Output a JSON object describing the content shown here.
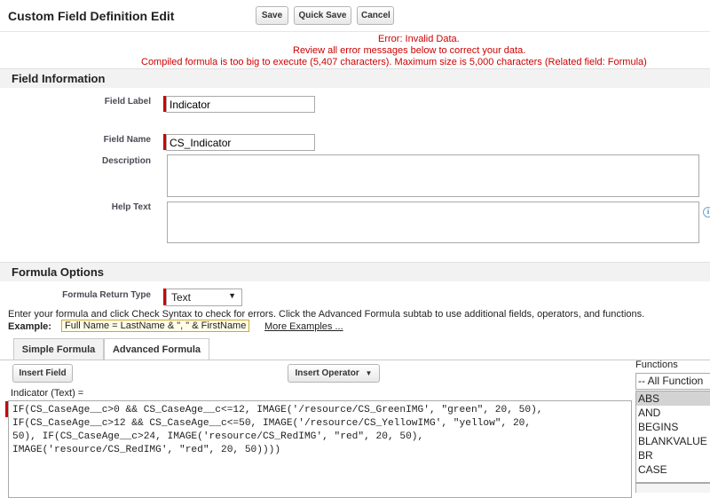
{
  "header": {
    "title": "Custom Field Definition Edit",
    "save_label": "Save",
    "quick_save_label": "Quick Save",
    "cancel_label": "Cancel"
  },
  "errors": {
    "line1": "Error: Invalid Data.",
    "line2": "Review all error messages below to correct your data.",
    "line3": "Compiled formula is too big to execute (5,407 characters). Maximum size is 5,000 characters (Related field: Formula)"
  },
  "field_info": {
    "section_title": "Field Information",
    "field_label_label": "Field Label",
    "field_label_value": "Indicator",
    "field_name_label": "Field Name",
    "field_name_value": "CS_Indicator",
    "description_label": "Description",
    "help_text_label": "Help Text",
    "help_icon": "i"
  },
  "formula_options": {
    "section_title": "Formula Options",
    "return_type_label": "Formula Return Type",
    "return_type_value": "Text",
    "instructions": "Enter your formula and click Check Syntax to check for errors. Click the Advanced Formula subtab to use additional fields, operators, and functions.",
    "example_label": "Example:",
    "example_value": "Full Name = LastName & \", \" & FirstName",
    "more_examples": "More Examples ..."
  },
  "tabs": [
    {
      "label": "Simple Formula"
    },
    {
      "label": "Advanced Formula"
    }
  ],
  "editor": {
    "insert_field_label": "Insert Field",
    "insert_operator_label": "Insert Operator",
    "formula_label": "Indicator (Text) =",
    "formula_text": "IF(CS_CaseAge__c>0 && CS_CaseAge__c<=12, IMAGE('/resource/CS_GreenIMG', \"green\", 20, 50),\nIF(CS_CaseAge__c>12 && CS_CaseAge__c<=50, IMAGE('/resource/CS_YellowIMG', \"yellow\", 20,\n50), IF(CS_CaseAge__c>24, IMAGE('resource/CS_RedIMG', \"red\", 20, 50),\nIMAGE('resource/CS_RedIMG', \"red\", 20, 50))))"
  },
  "functions": {
    "label": "Functions",
    "category_value": "-- All Function",
    "items": [
      "ABS",
      "AND",
      "BEGINS",
      "BLANKVALUE",
      "BR",
      "CASE"
    ]
  },
  "colors": {
    "error_red": "#cc0000",
    "required_bar": "#cc0000",
    "section_bg": "#f2f2f2",
    "selected_function_bg": "#d3d3d3"
  }
}
